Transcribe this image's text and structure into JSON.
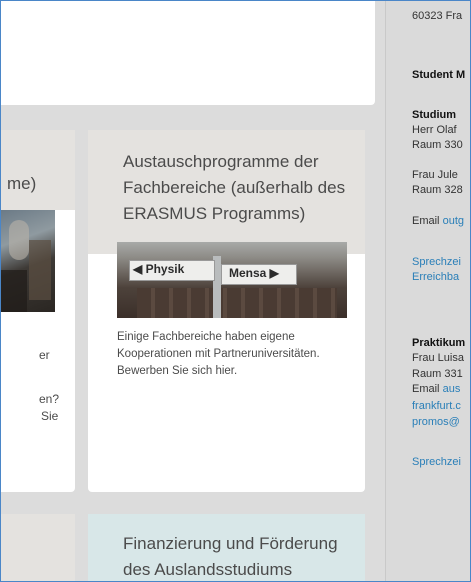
{
  "left_card": {
    "title_fragment": "me)",
    "body_lines": [
      "er",
      "en?",
      "Sie"
    ]
  },
  "exchange_card": {
    "title_lines": [
      "Austauschprogramme der",
      "Fachbereiche (außerhalb des",
      "ERASMUS Programms)"
    ],
    "sign_left": "◀ Physik",
    "sign_right": "Mensa ▶",
    "body_lines": [
      "Einige Fachbereiche haben eigene",
      "Kooperationen mit Partneruniversitäten.",
      "Bewerben Sie sich hier."
    ]
  },
  "funding_card": {
    "title_lines": [
      "Finanzierung und Förderung",
      "des Auslandsstudiums"
    ]
  },
  "sidebar": {
    "address": "60323 Fra",
    "student_heading": "Student M",
    "studium_heading": "Studium",
    "contact1_name": "Herr Olaf",
    "contact1_room": "Raum 330",
    "contact2_name": "Frau Jule",
    "contact2_room": "Raum 328",
    "email_label": "Email",
    "email_link": "outg",
    "hours_line1": "Sprechzei",
    "hours_line2": "Erreichba",
    "praktikum_heading": "Praktikum",
    "contact3_name": "Frau Luisa",
    "contact3_room": "Raum 331",
    "email2_label": "Email",
    "email2_link": "aus",
    "email2_cont1": "frankfurt.c",
    "email2_cont2": "promos@",
    "hours2": "Sprechzei"
  },
  "colors": {
    "link": "#2a7fb8",
    "frame_border": "#4a86c8",
    "card_bg": "#ffffff",
    "page_bg": "#dcdcdc"
  }
}
